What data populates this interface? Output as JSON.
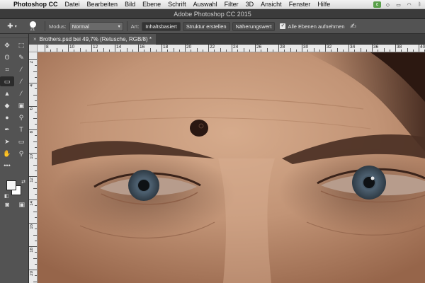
{
  "menubar": {
    "apple_icon": "apple-logo-icon",
    "items": [
      "Photoshop CC",
      "Datei",
      "Bearbeiten",
      "Bild",
      "Ebene",
      "Schrift",
      "Auswahl",
      "Filter",
      "3D",
      "Ansicht",
      "Fenster",
      "Hilfe"
    ],
    "status_icons": [
      "evernote-icon",
      "dropbox-icon",
      "airplay-icon",
      "wifi-icon",
      "bluetooth-icon"
    ]
  },
  "window": {
    "title": "Adobe Photoshop CC 2015"
  },
  "options": {
    "brush_size": "21",
    "mode_label": "Modus:",
    "mode_value": "Normal",
    "type_label": "Art:",
    "type_buttons": [
      "Inhaltsbasiert",
      "Struktur erstellen",
      "Näherungswert"
    ],
    "sample_all_label": "Alle Ebenen aufnehmen",
    "sample_all_checked": true
  },
  "tools": [
    {
      "name": "move-tool",
      "icon": "move-icon",
      "glyph": "✥"
    },
    {
      "name": "marquee-tool",
      "icon": "marquee-icon",
      "glyph": "⬚"
    },
    {
      "name": "lasso-tool",
      "icon": "lasso-icon",
      "glyph": "ʘ"
    },
    {
      "name": "quick-selection-tool",
      "icon": "quick-selection-icon",
      "glyph": "✎"
    },
    {
      "name": "crop-tool",
      "icon": "crop-icon",
      "glyph": "⌗"
    },
    {
      "name": "eyedropper-tool",
      "icon": "eyedropper-icon",
      "glyph": "⁄"
    },
    {
      "name": "spot-healing-tool",
      "icon": "band-aid-icon",
      "glyph": "▭",
      "selected": true
    },
    {
      "name": "brush-tool",
      "icon": "brush-icon",
      "glyph": "⁄"
    },
    {
      "name": "clone-stamp-tool",
      "icon": "stamp-icon",
      "glyph": "▲"
    },
    {
      "name": "history-brush-tool",
      "icon": "history-brush-icon",
      "glyph": "⁄"
    },
    {
      "name": "eraser-tool",
      "icon": "eraser-icon",
      "glyph": "◆"
    },
    {
      "name": "gradient-tool",
      "icon": "gradient-icon",
      "glyph": "▣"
    },
    {
      "name": "blur-tool",
      "icon": "blur-drop-icon",
      "glyph": "●"
    },
    {
      "name": "dodge-tool",
      "icon": "dodge-icon",
      "glyph": "⚲"
    },
    {
      "name": "pen-tool",
      "icon": "pen-icon",
      "glyph": "✒"
    },
    {
      "name": "type-tool",
      "icon": "type-icon",
      "glyph": "T"
    },
    {
      "name": "path-selection-tool",
      "icon": "path-selection-icon",
      "glyph": "➤"
    },
    {
      "name": "rectangle-tool",
      "icon": "rectangle-icon",
      "glyph": "▭"
    },
    {
      "name": "hand-tool",
      "icon": "hand-icon",
      "glyph": "✋"
    },
    {
      "name": "zoom-tool",
      "icon": "zoom-icon",
      "glyph": "⚲"
    },
    {
      "name": "more-tools",
      "icon": "ellipsis-icon",
      "glyph": "•••"
    },
    {
      "name": "empty",
      "icon": "",
      "glyph": ""
    }
  ],
  "colors": {
    "foreground": "#f5f5f5",
    "background": "#ffffff"
  },
  "document": {
    "tab_label": "Brothers.psd bei 49,7% (Retusche, RGB/8) *"
  },
  "ruler": {
    "top_labels": [
      "8",
      "10",
      "12",
      "14",
      "16",
      "18",
      "20",
      "22",
      "24",
      "26",
      "28",
      "30",
      "32",
      "34",
      "36",
      "38",
      "40"
    ],
    "left_labels": [
      "2",
      "4",
      "6",
      "8",
      "10",
      "12",
      "14",
      "16",
      "18",
      "20"
    ]
  }
}
